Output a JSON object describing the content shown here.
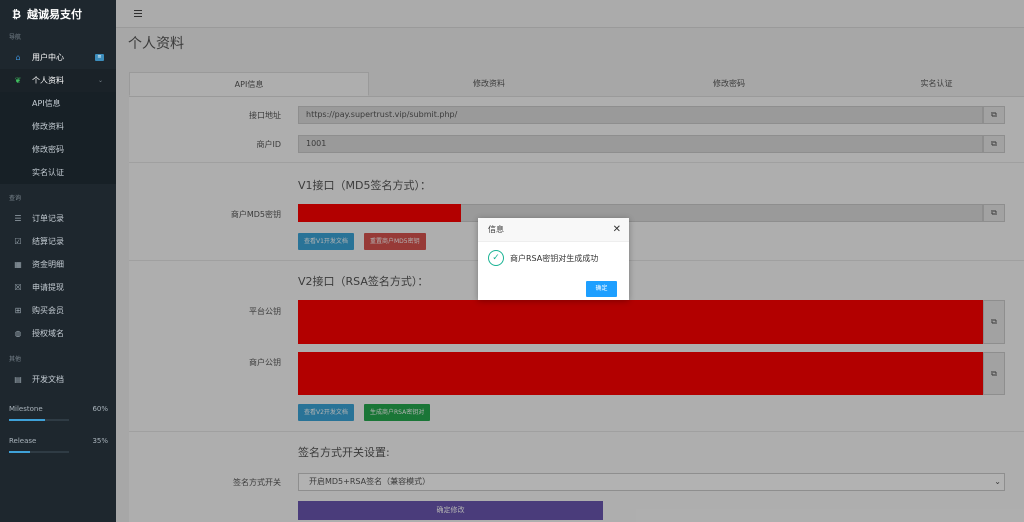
{
  "brand": {
    "logo": "₿",
    "name": "越诚易支付"
  },
  "sidebar": {
    "nav_label": "导航",
    "user_center": "用户中心",
    "profile": "个人资料",
    "sub_items": [
      "API信息",
      "修改资料",
      "修改密码",
      "实名认证"
    ],
    "query_label": "查询",
    "query_items": [
      {
        "label": "订单记录",
        "icon": "list-icon"
      },
      {
        "label": "结算记录",
        "icon": "check-square-icon"
      },
      {
        "label": "资金明细",
        "icon": "table-icon"
      },
      {
        "label": "申请提现",
        "icon": "withdraw-icon"
      },
      {
        "label": "购买会员",
        "icon": "cart-icon"
      },
      {
        "label": "授权域名",
        "icon": "globe-icon"
      }
    ],
    "other_label": "其他",
    "dev_docs": "开发文档",
    "progress": [
      {
        "label": "Milestone",
        "percent_text": "60%",
        "value": 0.6
      },
      {
        "label": "Release",
        "percent_text": "35%",
        "value": 0.35
      }
    ]
  },
  "page_title": "个人资料",
  "tabs": [
    "API信息",
    "修改资料",
    "修改密码",
    "实名认证"
  ],
  "form": {
    "api_url_label": "接口地址",
    "api_url": "https://pay.supertrust.vip/submit.php/",
    "merchant_id_label": "商户ID",
    "merchant_id": "1001",
    "v1_title": "V1接口（MD5签名方式）：",
    "md5_key_label": "商户MD5密钥",
    "btn_v1_docs": "查看V1开发文档",
    "btn_reset_md5": "重置商户MD5密钥",
    "v2_title": "V2接口（RSA签名方式）：",
    "platform_pubkey_label": "平台公钥",
    "merchant_pubkey_label": "商户公钥",
    "btn_v2_docs": "查看V2开发文档",
    "btn_gen_rsa": "生成商户RSA密钥对",
    "sign_title": "签名方式开关设置:",
    "sign_switch_label": "签名方式开关",
    "sign_switch_value": "开启MD5+RSA签名（兼容模式）",
    "submit": "确定修改"
  },
  "dialog": {
    "title": "信息",
    "message": "商户RSA密钥对生成成功",
    "ok": "确定"
  }
}
